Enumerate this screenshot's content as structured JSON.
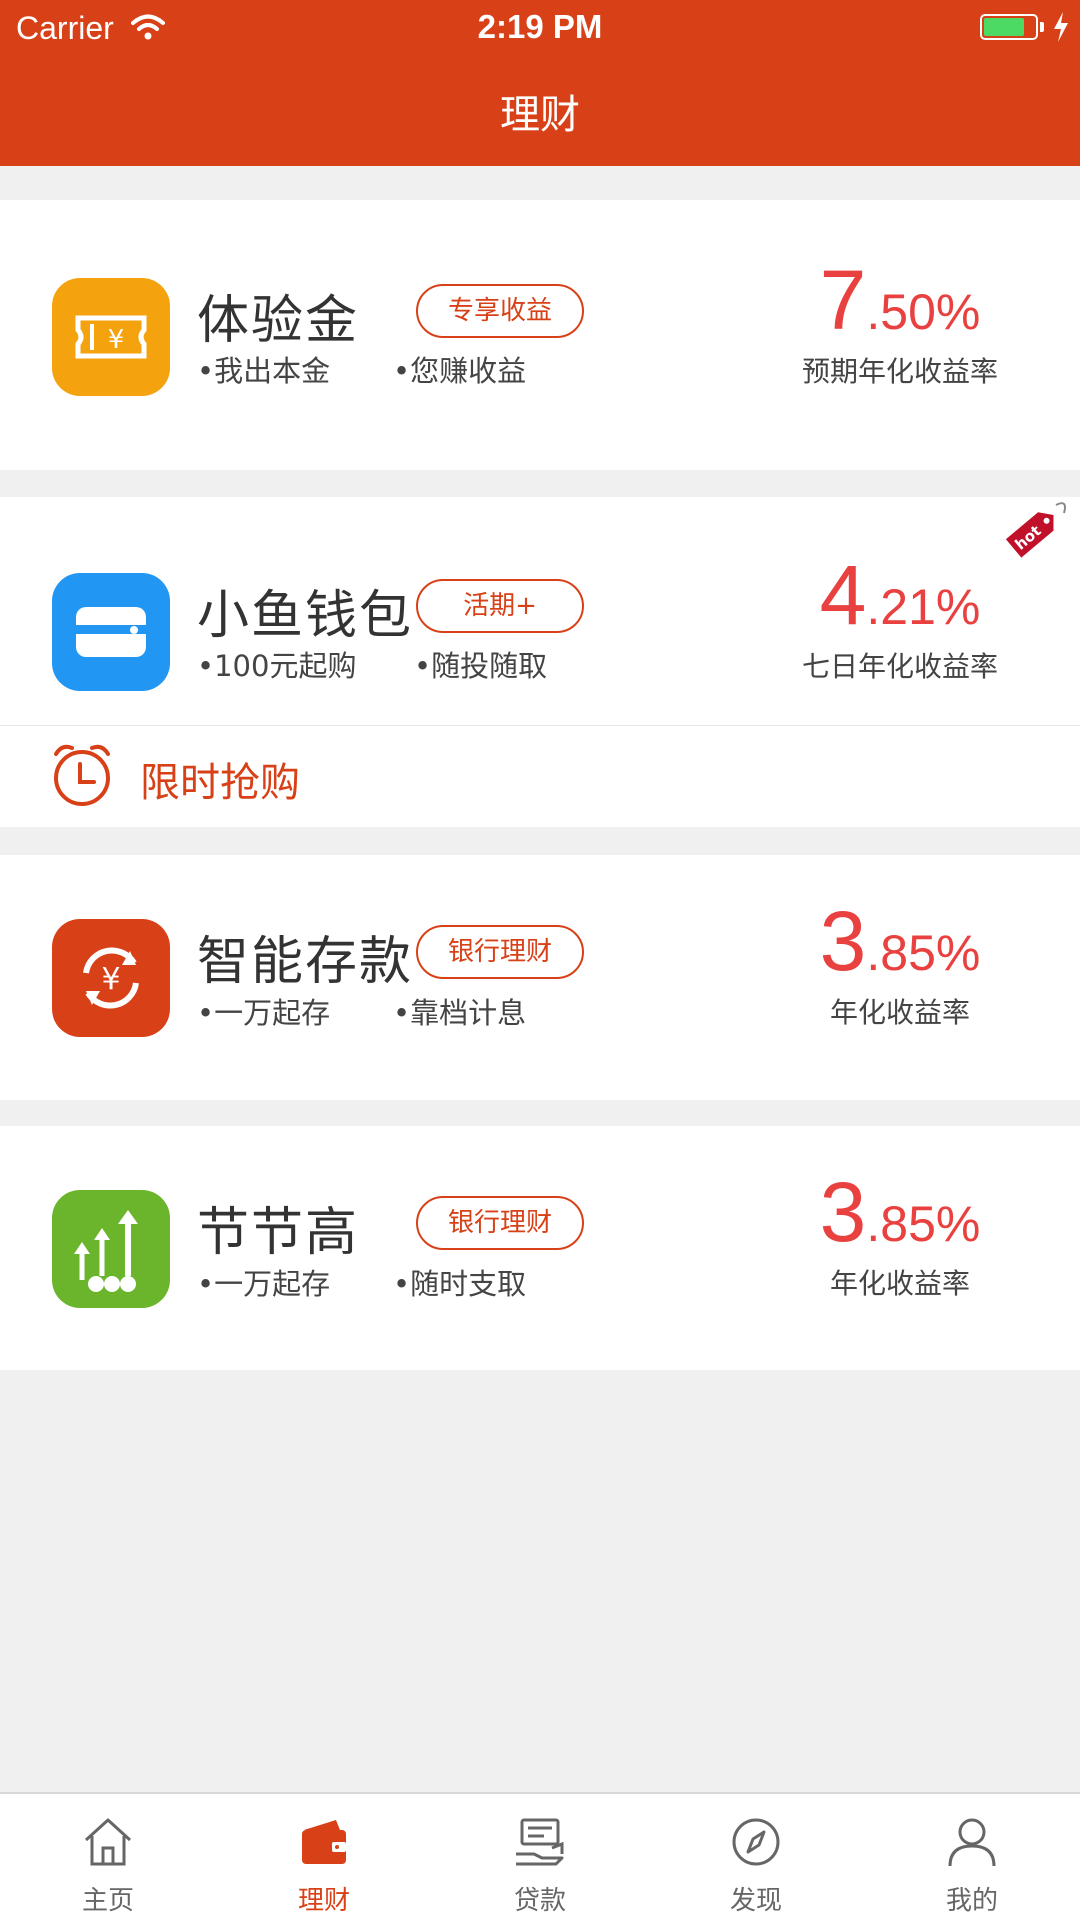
{
  "status_bar": {
    "carrier": "Carrier",
    "time": "2:19 PM",
    "battery_level": 0.8
  },
  "nav": {
    "title": "理财"
  },
  "products": [
    {
      "name": "体验金",
      "tag": "专享收益",
      "features": [
        "•我出本金",
        "•您赚收益"
      ],
      "rate_int": "7",
      "rate_dec": ".50%",
      "rate_label": "预期年化收益率",
      "icon": "ticket-yen-icon"
    },
    {
      "name": "小鱼钱包",
      "tag": "活期+",
      "features": [
        "•100元起购",
        "•随投随取"
      ],
      "rate_int": "4",
      "rate_dec": ".21%",
      "rate_label": "七日年化收益率",
      "icon": "wallet-card-icon",
      "badge": "hot"
    },
    {
      "name": "智能存款",
      "tag": "银行理财",
      "features": [
        "•一万起存",
        "•靠档计息"
      ],
      "rate_int": "3",
      "rate_dec": ".85%",
      "rate_label": "年化收益率",
      "icon": "yen-refresh-icon"
    },
    {
      "name": "节节高",
      "tag": "银行理财",
      "features": [
        "•一万起存",
        "•随时支取"
      ],
      "rate_int": "3",
      "rate_dec": ".85%",
      "rate_label": "年化收益率",
      "icon": "growth-arrows-icon"
    }
  ],
  "flash_sale": {
    "label": "限时抢购",
    "icon": "alarm-clock-icon"
  },
  "tabbar": {
    "active_index": 1,
    "tabs": [
      {
        "label": "主页",
        "icon": "home-icon"
      },
      {
        "label": "理财",
        "icon": "wallet-icon"
      },
      {
        "label": "贷款",
        "icon": "loan-icon"
      },
      {
        "label": "发现",
        "icon": "compass-icon"
      },
      {
        "label": "我的",
        "icon": "user-icon"
      }
    ]
  },
  "colors": {
    "brand": "#d84117",
    "rate": "#e8413f",
    "background": "#f0f0f0"
  }
}
